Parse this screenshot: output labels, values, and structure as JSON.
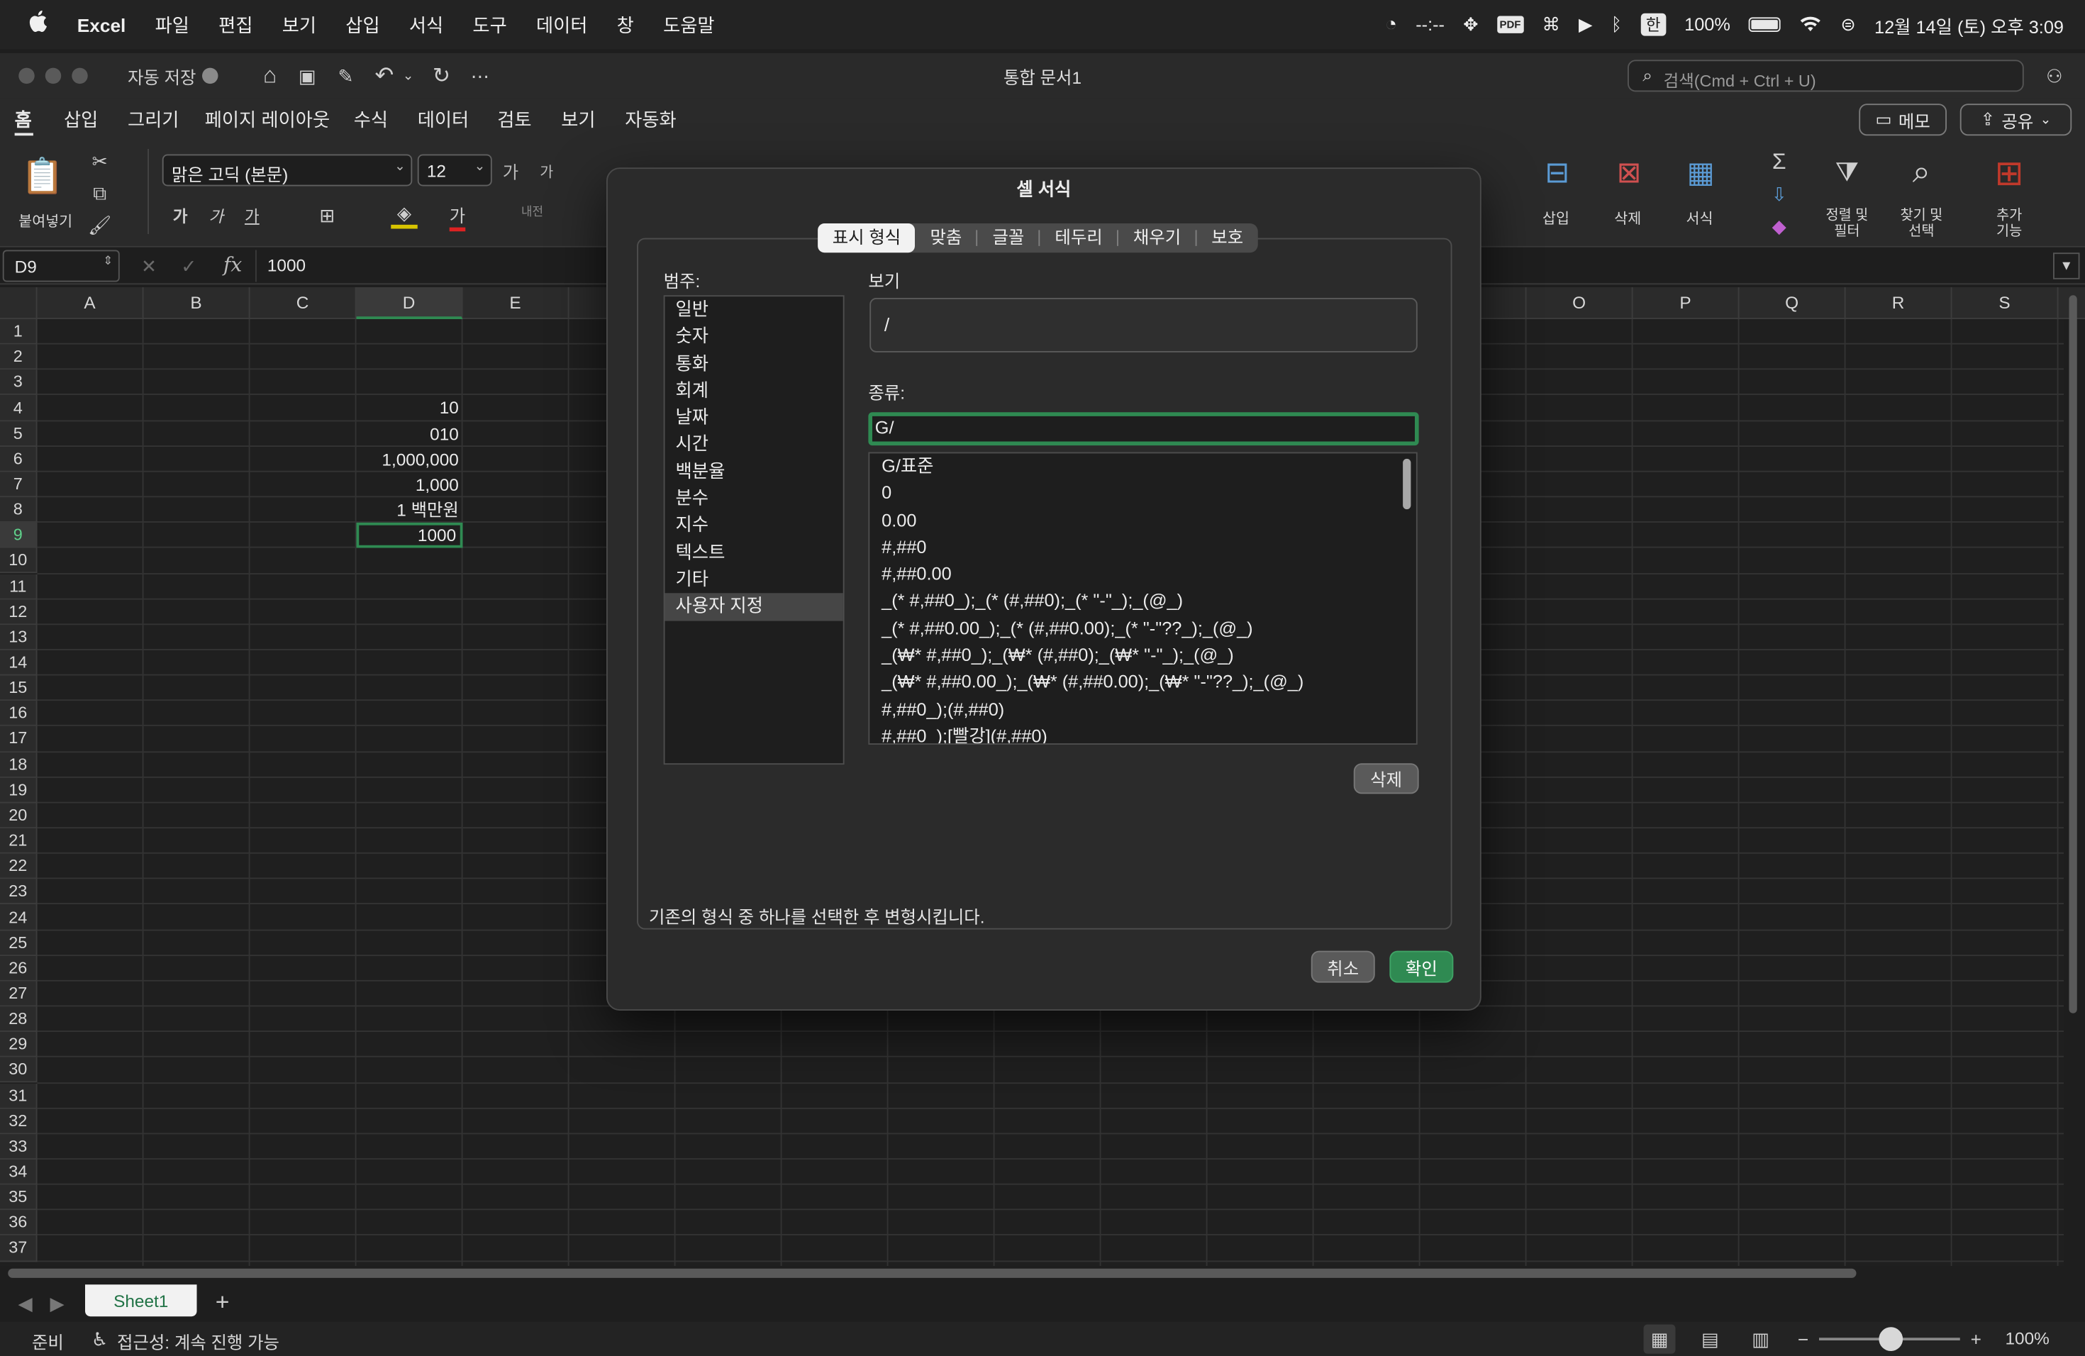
{
  "menubar": {
    "apple": "",
    "app": "Excel",
    "items": [
      "파일",
      "편집",
      "보기",
      "삽입",
      "서식",
      "도구",
      "데이터",
      "창",
      "도움말"
    ],
    "status": {
      "timer": "--:--",
      "pdf": "PDF",
      "input": "한",
      "battery": "100%",
      "datetime": "12월 14일 (토) 오후 3:09"
    }
  },
  "titlebar": {
    "autosave_label": "자동 저장",
    "doc_title": "통합 문서1",
    "search_placeholder": "검색(Cmd + Ctrl + U)"
  },
  "ribbon_tabs": {
    "tabs": [
      "홈",
      "삽입",
      "그리기",
      "페이지 레이아웃",
      "수식",
      "데이터",
      "검토",
      "보기",
      "자동화"
    ],
    "active": "홈",
    "memo_label": "메모",
    "share_label": "공유"
  },
  "ribbon": {
    "paste_label": "붙여넣기",
    "font_name": "맑은 고딕 (본문)",
    "font_size": "12",
    "grow_font": "가",
    "shrink_font": "가",
    "bold": "가",
    "italic": "가",
    "underline": "가",
    "font_color": "가",
    "wrap": "내전",
    "insert_label": "삽입",
    "delete_label": "삭제",
    "format_label": "서식",
    "sort_label": "정렬 및\n필터",
    "find_label": "찾기 및\n선택",
    "addins_label": "추가\n기능"
  },
  "formula_bar": {
    "name_box": "D9",
    "fx": "fx",
    "content": "1000"
  },
  "grid": {
    "columns_left": [
      "A",
      "B",
      "C",
      "D",
      "E"
    ],
    "columns_right": [
      "O",
      "P",
      "Q",
      "R",
      "S"
    ],
    "rows": [
      "1",
      "2",
      "3",
      "4",
      "5",
      "6",
      "7",
      "8",
      "9",
      "10",
      "11",
      "12",
      "13",
      "14",
      "15",
      "16",
      "17",
      "18",
      "19",
      "20",
      "21",
      "22",
      "23",
      "24",
      "25",
      "26",
      "27",
      "28",
      "29",
      "30",
      "31",
      "32",
      "33",
      "34",
      "35",
      "36",
      "37"
    ],
    "cells": [
      {
        "row": "4",
        "col": "D",
        "value": "10"
      },
      {
        "row": "5",
        "col": "D",
        "value": "010"
      },
      {
        "row": "6",
        "col": "D",
        "value": "1,000,000"
      },
      {
        "row": "7",
        "col": "D",
        "value": "1,000"
      },
      {
        "row": "8",
        "col": "D",
        "value": "1 백만원"
      },
      {
        "row": "9",
        "col": "D",
        "value": "1000"
      }
    ],
    "selected_cell": "D9"
  },
  "dialog": {
    "title": "셀 서식",
    "tabs": [
      "표시 형식",
      "맞춤",
      "글꼴",
      "테두리",
      "채우기",
      "보호"
    ],
    "active_tab": "표시 형식",
    "category_label": "범주:",
    "categories": [
      "일반",
      "숫자",
      "통화",
      "회계",
      "날짜",
      "시간",
      "백분율",
      "분수",
      "지수",
      "텍스트",
      "기타",
      "사용자 지정"
    ],
    "selected_category": "사용자 지정",
    "preview_label": "보기",
    "preview_value": "/",
    "type_label": "종류:",
    "type_value": "G/",
    "formats": [
      "G/표준",
      "0",
      "0.00",
      "#,##0",
      "#,##0.00",
      "_(* #,##0_);_(* (#,##0);_(* \"-\"_);_(@_)",
      "_(* #,##0.00_);_(* (#,##0.00);_(* \"-\"??_);_(@_)",
      "_(₩* #,##0_);_(₩* (#,##0);_(₩* \"-\"_);_(@_)",
      "_(₩* #,##0.00_);_(₩* (#,##0.00);_(₩* \"-\"??_);_(@_)",
      "#,##0_);(#,##0)",
      "#,##0_);[빨강](#,##0)"
    ],
    "delete_label": "삭제",
    "hint": "기존의 형식 중 하나를 선택한 후 변형시킵니다.",
    "cancel_label": "취소",
    "ok_label": "확인"
  },
  "sheets": {
    "tabs": [
      "Sheet1"
    ],
    "add": "+"
  },
  "statusbar": {
    "ready": "준비",
    "accessibility": "접근성: 계속 진행 가능",
    "zoom": "100%"
  },
  "colors": {
    "accent_green": "#217346",
    "ok_button": "#2f8a52",
    "selection": "#1e6f3e"
  }
}
